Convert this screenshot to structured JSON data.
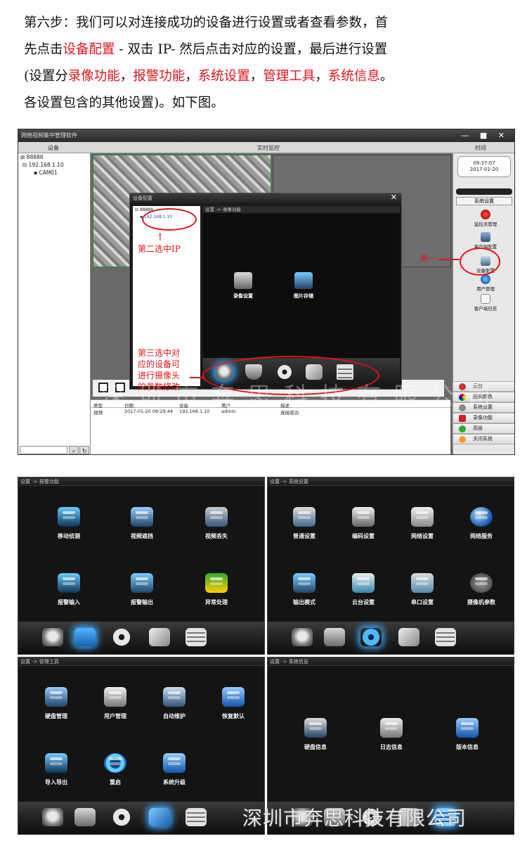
{
  "intro": {
    "l1": "第六步：我们可以对连接成功的设备进行设置或者查看参数，首",
    "l2a": "先点击",
    "l2b": "设备配置",
    "l2c": " - 双击 IP- 然后点击对应的设置，最后进行设置",
    "l3a": "(设置分",
    "l3b": "录像功能",
    "l3c": "，",
    "l3d": "报警功能",
    "l3e": "，",
    "l3f": "系统设置",
    "l3g": "，",
    "l3h": "管理工具",
    "l3i": "，",
    "l3j": "系统信息",
    "l3k": "。",
    "l4": "各设置包含的其他设置)。如下图。",
    "red_color": "#e0141c"
  },
  "shot1": {
    "window_title": "网络视频集中管理软件",
    "window_buttons": "— ■ ✕",
    "header_device": "设备",
    "header_live": "实时监控",
    "header_time": "时间",
    "tree": [
      "88888",
      "192.168.1.10",
      "CAM01"
    ],
    "clock_time": "09:37:07",
    "clock_date": "2017-01-20",
    "sys_settings": "系统设置",
    "side_buttons": [
      "监控点管理",
      "客户端配置",
      "设备配置",
      "用户管理",
      "客户端日志"
    ],
    "menu_items": [
      "云台",
      "图像颜色",
      "系统设置",
      "录像功能",
      "高级",
      "关闭系统"
    ],
    "log_headers": [
      "类型",
      "日期",
      "设备",
      "用户",
      "描述"
    ],
    "log_row": [
      "视频",
      "2017-01-20 09:29:44",
      "192.168.1.10",
      "admin",
      "连接成功"
    ],
    "dialog": {
      "title": "设备配置",
      "close": "✕",
      "tree_root": "88888",
      "tree_ip": "192.168.1.10",
      "crumb": "设置 -> 录像功能",
      "icons": [
        "录像设置",
        "图片存储"
      ]
    },
    "annotations": {
      "step1": "第一",
      "step2": "第二选中IP",
      "step3": [
        "第三选中对",
        "应的设备可",
        "进行摄像头",
        "的参数修改"
      ]
    },
    "faint_watermark": "深圳市奔思科技有限公司"
  },
  "panels": [
    {
      "crumb": "设置 -> 报警功能",
      "icons": [
        "移动侦测",
        "视频遮挡",
        "视频丢失",
        "报警输入",
        "报警输出",
        "异常处理"
      ],
      "active_tab": "alarm"
    },
    {
      "crumb": "设置 -> 系统设置",
      "icons": [
        "普通设置",
        "编码设置",
        "网络设置",
        "网络服务",
        "输出模式",
        "云台设置",
        "串口设置",
        "摄像机参数"
      ],
      "active_tab": "gear"
    },
    {
      "crumb": "设置 -> 管理工具",
      "icons": [
        "硬盘管理",
        "用户管理",
        "自动维护",
        "恢复默认",
        "导入导出",
        "重启",
        "系统升级"
      ],
      "active_tab": "tool"
    },
    {
      "crumb": "设置 -> 系统信息",
      "icons": [
        "硬盘信息",
        "日志信息",
        "版本信息"
      ],
      "active_tab": "info"
    }
  ],
  "watermark": "深圳市奔思科技有限公司"
}
